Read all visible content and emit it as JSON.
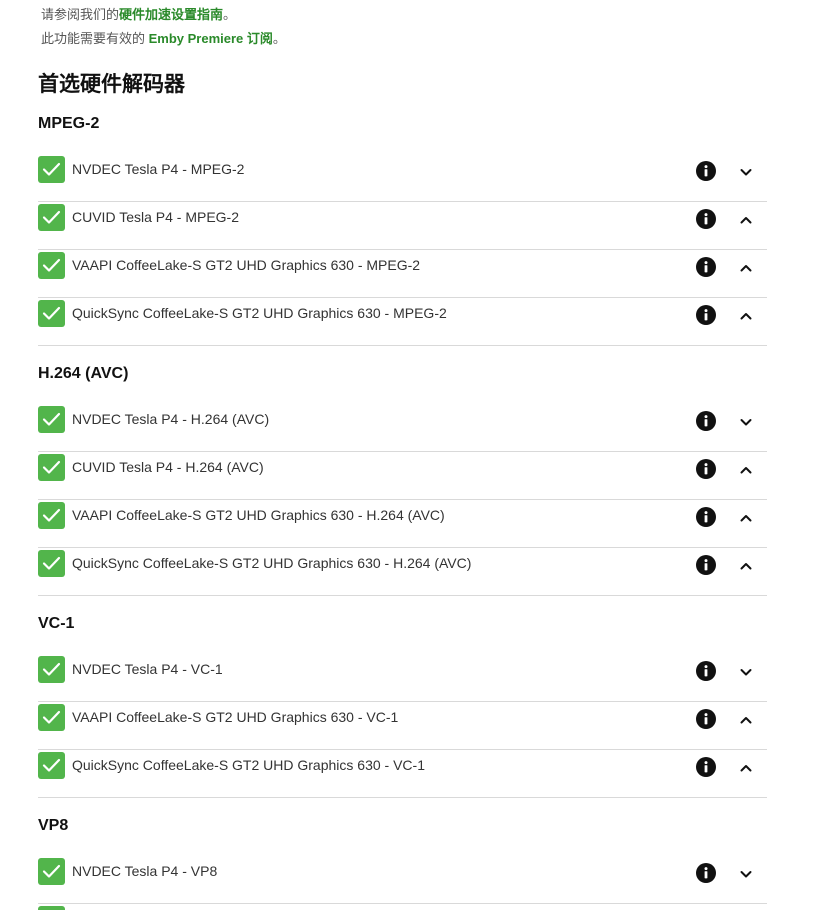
{
  "help": {
    "line1_prefix": "请参阅我们的",
    "line1_link": "硬件加速设置指南",
    "line1_suffix": "。",
    "line2_prefix": "此功能需要有效的 ",
    "line2_link": "Emby Premiere 订阅",
    "line2_suffix": "。"
  },
  "section": {
    "title": "首选硬件解码器"
  },
  "colors": {
    "checkbox": "#52b54b",
    "link": "#2a8a2a",
    "divider": "#d9d9d9"
  },
  "groups": [
    {
      "name": "MPEG-2",
      "items": [
        {
          "label": "NVDEC Tesla P4 - MPEG-2",
          "checked": true,
          "chevron": "chevron-down-icon"
        },
        {
          "label": "CUVID Tesla P4 - MPEG-2",
          "checked": true,
          "chevron": "chevron-up-icon"
        },
        {
          "label": "VAAPI CoffeeLake-S GT2 UHD Graphics 630 - MPEG-2",
          "checked": true,
          "chevron": "chevron-up-icon"
        },
        {
          "label": "QuickSync CoffeeLake-S GT2 UHD Graphics 630 - MPEG-2",
          "checked": true,
          "chevron": "chevron-up-icon"
        }
      ]
    },
    {
      "name": "H.264 (AVC)",
      "items": [
        {
          "label": "NVDEC Tesla P4 - H.264 (AVC)",
          "checked": true,
          "chevron": "chevron-down-icon"
        },
        {
          "label": "CUVID Tesla P4 - H.264 (AVC)",
          "checked": true,
          "chevron": "chevron-up-icon"
        },
        {
          "label": "VAAPI CoffeeLake-S GT2 UHD Graphics 630 - H.264 (AVC)",
          "checked": true,
          "chevron": "chevron-up-icon"
        },
        {
          "label": "QuickSync CoffeeLake-S GT2 UHD Graphics 630 - H.264 (AVC)",
          "checked": true,
          "chevron": "chevron-up-icon"
        }
      ]
    },
    {
      "name": "VC-1",
      "items": [
        {
          "label": "NVDEC Tesla P4 - VC-1",
          "checked": true,
          "chevron": "chevron-down-icon"
        },
        {
          "label": "VAAPI CoffeeLake-S GT2 UHD Graphics 630 - VC-1",
          "checked": true,
          "chevron": "chevron-up-icon"
        },
        {
          "label": "QuickSync CoffeeLake-S GT2 UHD Graphics 630 - VC-1",
          "checked": true,
          "chevron": "chevron-up-icon"
        }
      ]
    },
    {
      "name": "VP8",
      "items": [
        {
          "label": "NVDEC Tesla P4 - VP8",
          "checked": true,
          "chevron": "chevron-down-icon"
        },
        {
          "label": "",
          "checked": true,
          "chevron": "chevron-up-icon"
        }
      ]
    }
  ]
}
